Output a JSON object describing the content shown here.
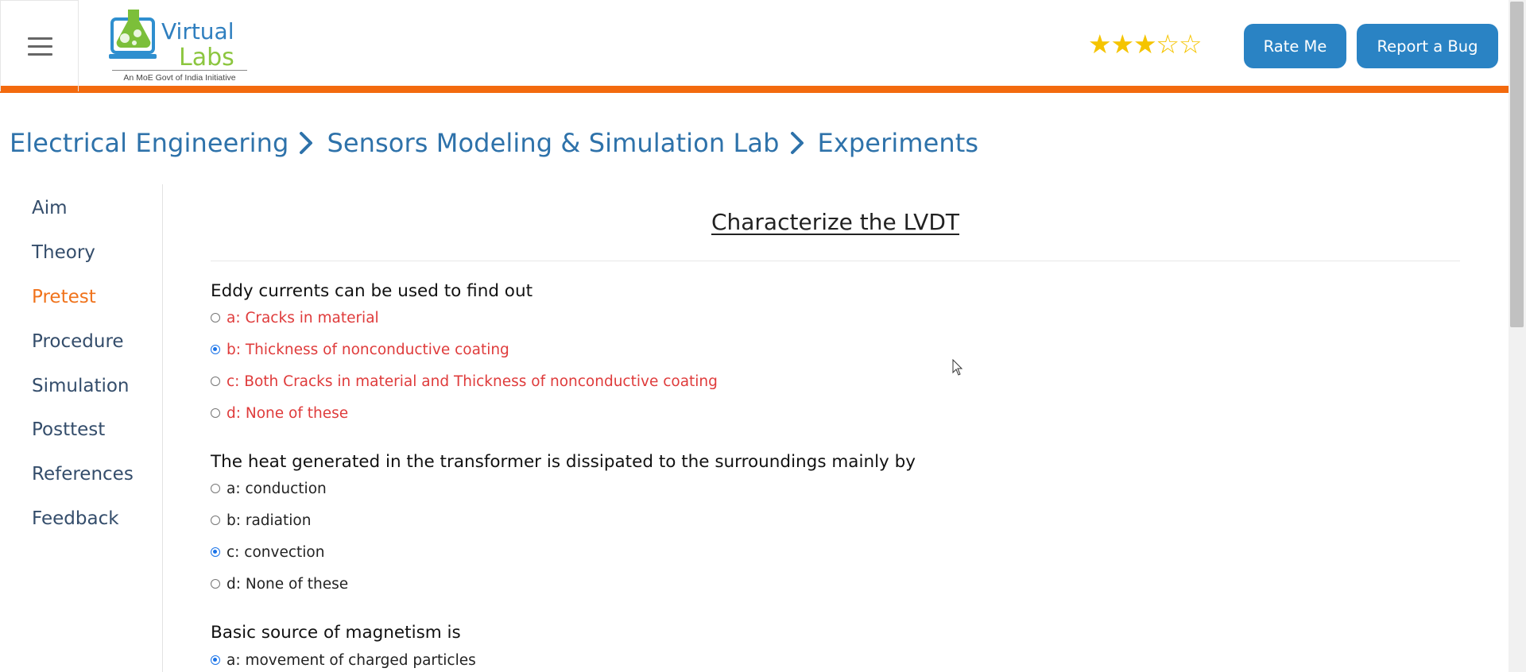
{
  "header": {
    "logo_title_line1": "Virtual",
    "logo_title_line2": "Labs",
    "logo_tagline": "An MoE Govt of India Initiative",
    "rating": {
      "value": 3.5,
      "max": 5
    },
    "rate_button": "Rate Me",
    "bug_button": "Report a Bug"
  },
  "breadcrumb": [
    "Electrical Engineering",
    "Sensors Modeling & Simulation Lab",
    "Experiments"
  ],
  "sidebar": {
    "items": [
      {
        "label": "Aim",
        "active": false
      },
      {
        "label": "Theory",
        "active": false
      },
      {
        "label": "Pretest",
        "active": true
      },
      {
        "label": "Procedure",
        "active": false
      },
      {
        "label": "Simulation",
        "active": false
      },
      {
        "label": "Posttest",
        "active": false
      },
      {
        "label": "References",
        "active": false
      },
      {
        "label": "Feedback",
        "active": false
      }
    ]
  },
  "main": {
    "title": "Characterize the LVDT",
    "questions": [
      {
        "text": "Eddy currents can be used to find out",
        "options": [
          {
            "label": "a: Cracks in material",
            "checked": false,
            "style": "wrong"
          },
          {
            "label": "b: Thickness of nonconductive coating",
            "checked": true,
            "style": "wrong"
          },
          {
            "label": "c: Both Cracks in material and Thickness of nonconductive coating",
            "checked": false,
            "style": "wrong"
          },
          {
            "label": "d: None of these",
            "checked": false,
            "style": "wrong"
          }
        ]
      },
      {
        "text": "The heat generated in the transformer is dissipated to the surroundings mainly by",
        "options": [
          {
            "label": "a: conduction",
            "checked": false,
            "style": "normal"
          },
          {
            "label": "b: radiation",
            "checked": false,
            "style": "normal"
          },
          {
            "label": "c: convection",
            "checked": true,
            "style": "normal"
          },
          {
            "label": "d: None of these",
            "checked": false,
            "style": "normal"
          }
        ]
      },
      {
        "text": "Basic source of magnetism is",
        "options": [
          {
            "label": "a: movement of charged particles",
            "checked": true,
            "style": "normal"
          }
        ]
      }
    ]
  },
  "colors": {
    "accent_orange": "#f36a0e",
    "button_blue": "#2a83c4",
    "link_blue": "#2e72aa",
    "wrong_red": "#df3b3b",
    "star_gold": "#f5c400"
  }
}
